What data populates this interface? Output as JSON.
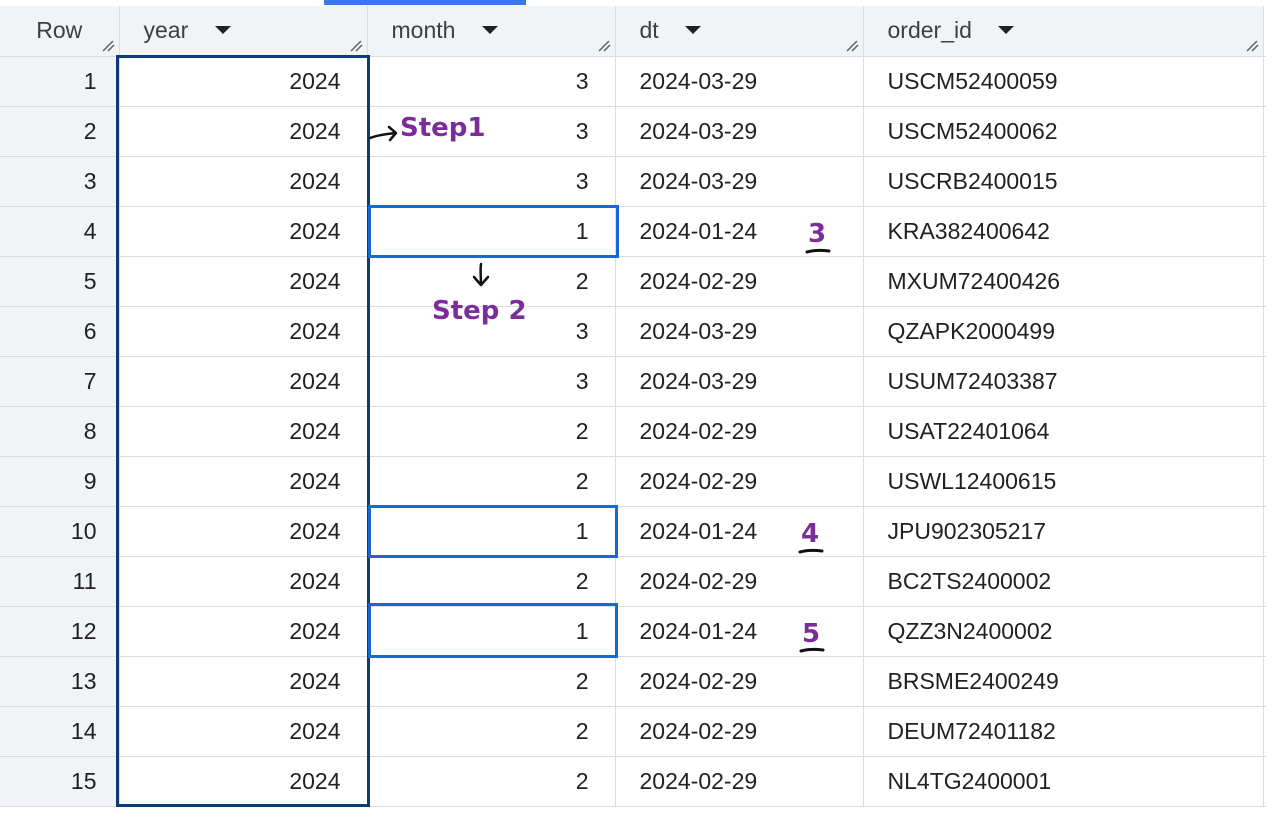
{
  "columns": {
    "row": "Row",
    "year": "year",
    "month": "month",
    "dt": "dt",
    "order_id": "order_id"
  },
  "rows": [
    {
      "row": "1",
      "year": "2024",
      "month": "3",
      "dt": "2024-03-29",
      "order_id": "USCM52400059"
    },
    {
      "row": "2",
      "year": "2024",
      "month": "3",
      "dt": "2024-03-29",
      "order_id": "USCM52400062"
    },
    {
      "row": "3",
      "year": "2024",
      "month": "3",
      "dt": "2024-03-29",
      "order_id": "USCRB2400015"
    },
    {
      "row": "4",
      "year": "2024",
      "month": "1",
      "dt": "2024-01-24",
      "order_id": "KRA382400642"
    },
    {
      "row": "5",
      "year": "2024",
      "month": "2",
      "dt": "2024-02-29",
      "order_id": "MXUM72400426"
    },
    {
      "row": "6",
      "year": "2024",
      "month": "3",
      "dt": "2024-03-29",
      "order_id": "QZAPK2000499"
    },
    {
      "row": "7",
      "year": "2024",
      "month": "3",
      "dt": "2024-03-29",
      "order_id": "USUM72403387"
    },
    {
      "row": "8",
      "year": "2024",
      "month": "2",
      "dt": "2024-02-29",
      "order_id": "USAT22401064"
    },
    {
      "row": "9",
      "year": "2024",
      "month": "2",
      "dt": "2024-02-29",
      "order_id": "USWL12400615"
    },
    {
      "row": "10",
      "year": "2024",
      "month": "1",
      "dt": "2024-01-24",
      "order_id": "JPU902305217"
    },
    {
      "row": "11",
      "year": "2024",
      "month": "2",
      "dt": "2024-02-29",
      "order_id": "BC2TS2400002"
    },
    {
      "row": "12",
      "year": "2024",
      "month": "1",
      "dt": "2024-01-24",
      "order_id": "QZZ3N2400002"
    },
    {
      "row": "13",
      "year": "2024",
      "month": "2",
      "dt": "2024-02-29",
      "order_id": "BRSME2400249"
    },
    {
      "row": "14",
      "year": "2024",
      "month": "2",
      "dt": "2024-02-29",
      "order_id": "DEUM72401182"
    },
    {
      "row": "15",
      "year": "2024",
      "month": "2",
      "dt": "2024-02-29",
      "order_id": "NL4TG2400001"
    }
  ],
  "annotations": {
    "step1": "Step1",
    "step2": "Step 2",
    "n3": "3",
    "n4": "4",
    "n5": "5",
    "color": "#7b2d9a"
  },
  "highlight_colors": {
    "year_column_box": "#0d3b7a",
    "month_cell_box": "#1967d2"
  }
}
